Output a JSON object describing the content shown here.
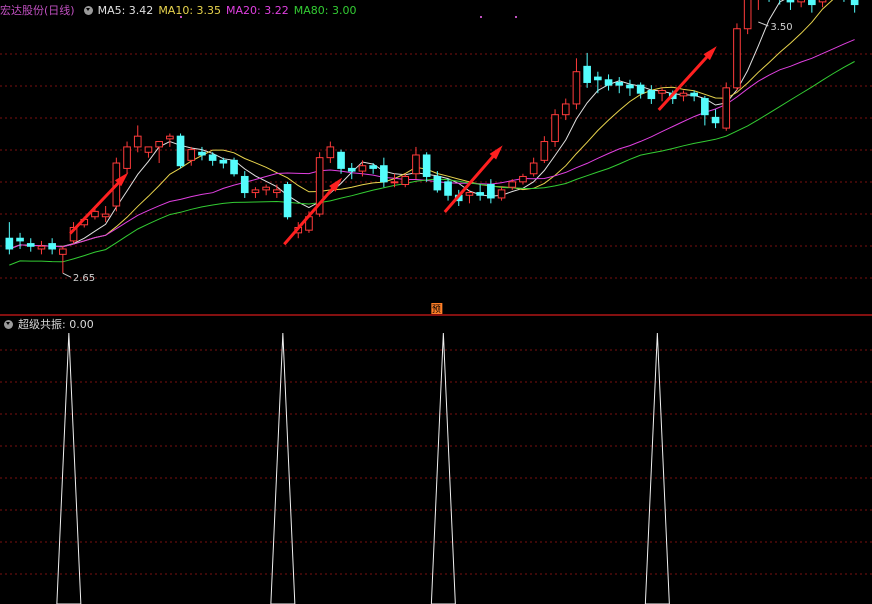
{
  "header": {
    "stock_name": "宏达股份",
    "period": "(日线)",
    "ma": [
      {
        "label": "MA5: 3.42",
        "color": "#e0e0e0"
      },
      {
        "label": "MA10: 3.35",
        "color": "#e8d44d"
      },
      {
        "label": "MA20: 3.22",
        "color": "#e040e0"
      },
      {
        "label": "MA80: 3.00",
        "color": "#33cc33"
      }
    ]
  },
  "indicator": {
    "label": "超级共振",
    "value": ": 0.00"
  },
  "colors": {
    "up": "#ff3b3b",
    "down": "#54fcfc",
    "grid": "#7a1010",
    "divider": "#b01515",
    "title": "#c050c0",
    "arrow": "#ff2020",
    "badge": "#ff7f27"
  },
  "chart_data": [
    {
      "type": "candlestick",
      "price_axis": [
        2.55,
        3.6
      ],
      "high_label": "3.50",
      "low_label": "2.65",
      "badge": "预",
      "ohlc": [
        [
          2.78,
          2.84,
          2.74,
          2.72
        ],
        [
          2.78,
          2.8,
          2.77,
          2.74
        ],
        [
          2.76,
          2.78,
          2.75,
          2.73
        ],
        [
          2.74,
          2.77,
          2.75,
          2.72
        ],
        [
          2.76,
          2.78,
          2.74,
          2.72
        ],
        [
          2.72,
          2.75,
          2.74,
          2.65
        ],
        [
          2.77,
          2.84,
          2.82,
          2.76
        ],
        [
          2.83,
          2.86,
          2.85,
          2.82
        ],
        [
          2.86,
          2.9,
          2.88,
          2.85
        ],
        [
          2.86,
          2.9,
          2.87,
          2.84
        ],
        [
          2.9,
          3.08,
          3.06,
          2.88
        ],
        [
          3.04,
          3.14,
          3.12,
          3.02
        ],
        [
          3.12,
          3.2,
          3.16,
          3.1
        ],
        [
          3.1,
          3.12,
          3.12,
          3.08
        ],
        [
          3.12,
          3.14,
          3.14,
          3.06
        ],
        [
          3.15,
          3.17,
          3.16,
          3.12
        ],
        [
          3.16,
          3.17,
          3.05,
          3.04
        ],
        [
          3.07,
          3.12,
          3.11,
          3.05
        ],
        [
          3.1,
          3.12,
          3.09,
          3.07
        ],
        [
          3.09,
          3.1,
          3.07,
          3.05
        ],
        [
          3.07,
          3.08,
          3.06,
          3.04
        ],
        [
          3.07,
          3.08,
          3.02,
          3.01
        ],
        [
          3.01,
          3.03,
          2.95,
          2.93
        ],
        [
          2.95,
          2.97,
          2.96,
          2.93
        ],
        [
          2.96,
          2.98,
          2.97,
          2.94
        ],
        [
          2.95,
          2.98,
          2.96,
          2.93
        ],
        [
          2.98,
          2.99,
          2.86,
          2.85
        ],
        [
          2.8,
          2.84,
          2.82,
          2.78
        ],
        [
          2.81,
          2.88,
          2.86,
          2.8
        ],
        [
          2.87,
          3.1,
          3.08,
          2.86
        ],
        [
          3.08,
          3.14,
          3.12,
          3.06
        ],
        [
          3.1,
          3.11,
          3.04,
          3.02
        ],
        [
          3.04,
          3.06,
          3.03,
          3.0
        ],
        [
          3.03,
          3.07,
          3.05,
          3.01
        ],
        [
          3.05,
          3.06,
          3.04,
          3.02
        ],
        [
          3.05,
          3.08,
          2.99,
          2.97
        ],
        [
          2.99,
          3.02,
          2.99,
          2.97
        ],
        [
          2.98,
          3.02,
          3.01,
          2.97
        ],
        [
          3.02,
          3.12,
          3.09,
          3.0
        ],
        [
          3.09,
          3.1,
          3.01,
          2.99
        ],
        [
          3.01,
          3.03,
          2.96,
          2.95
        ],
        [
          2.99,
          3.0,
          2.94,
          2.92
        ],
        [
          2.94,
          2.96,
          2.92,
          2.9
        ],
        [
          2.94,
          2.96,
          2.95,
          2.91
        ],
        [
          2.95,
          2.98,
          2.94,
          2.92
        ],
        [
          2.98,
          3.0,
          2.93,
          2.91
        ],
        [
          2.93,
          2.97,
          2.96,
          2.92
        ],
        [
          2.97,
          3.0,
          2.99,
          2.96
        ],
        [
          2.99,
          3.02,
          3.01,
          2.98
        ],
        [
          3.02,
          3.08,
          3.06,
          3.01
        ],
        [
          3.07,
          3.16,
          3.14,
          3.06
        ],
        [
          3.14,
          3.26,
          3.24,
          3.12
        ],
        [
          3.24,
          3.3,
          3.28,
          3.22
        ],
        [
          3.28,
          3.45,
          3.4,
          3.26
        ],
        [
          3.42,
          3.47,
          3.36,
          3.34
        ],
        [
          3.38,
          3.4,
          3.37,
          3.32
        ],
        [
          3.37,
          3.39,
          3.35,
          3.33
        ],
        [
          3.36,
          3.38,
          3.35,
          3.32
        ],
        [
          3.35,
          3.37,
          3.34,
          3.31
        ],
        [
          3.35,
          3.36,
          3.32,
          3.3
        ],
        [
          3.33,
          3.35,
          3.3,
          3.28
        ],
        [
          3.32,
          3.34,
          3.33,
          3.29
        ],
        [
          3.32,
          3.33,
          3.3,
          3.28
        ],
        [
          3.31,
          3.33,
          3.32,
          3.29
        ],
        [
          3.32,
          3.33,
          3.31,
          3.29
        ],
        [
          3.3,
          3.31,
          3.24,
          3.2
        ],
        [
          3.23,
          3.26,
          3.21,
          3.19
        ],
        [
          3.19,
          3.36,
          3.34,
          3.18
        ],
        [
          3.34,
          3.58,
          3.56,
          3.33
        ],
        [
          3.56,
          3.7,
          3.67,
          3.54
        ],
        [
          3.67,
          3.74,
          3.7,
          3.63
        ],
        [
          3.7,
          3.73,
          3.69,
          3.66
        ],
        [
          3.69,
          3.72,
          3.68,
          3.65
        ],
        [
          3.68,
          3.71,
          3.66,
          3.63
        ],
        [
          3.66,
          3.69,
          3.68,
          3.64
        ],
        [
          3.68,
          3.7,
          3.65,
          3.62
        ],
        [
          3.66,
          3.71,
          3.7,
          3.64
        ],
        [
          3.7,
          3.74,
          3.71,
          3.67
        ],
        [
          3.7,
          3.72,
          3.69,
          3.66
        ],
        [
          3.7,
          3.73,
          3.65,
          3.62
        ]
      ],
      "ma80_endpoints": [
        3.0
      ],
      "signal_bars": [
        5,
        25,
        40,
        60
      ],
      "arrows_at": [
        7,
        27,
        42,
        62
      ]
    },
    {
      "type": "area",
      "name": "超级共振",
      "value": 0.0,
      "spike_bars": [
        5,
        25,
        40,
        60
      ]
    }
  ]
}
